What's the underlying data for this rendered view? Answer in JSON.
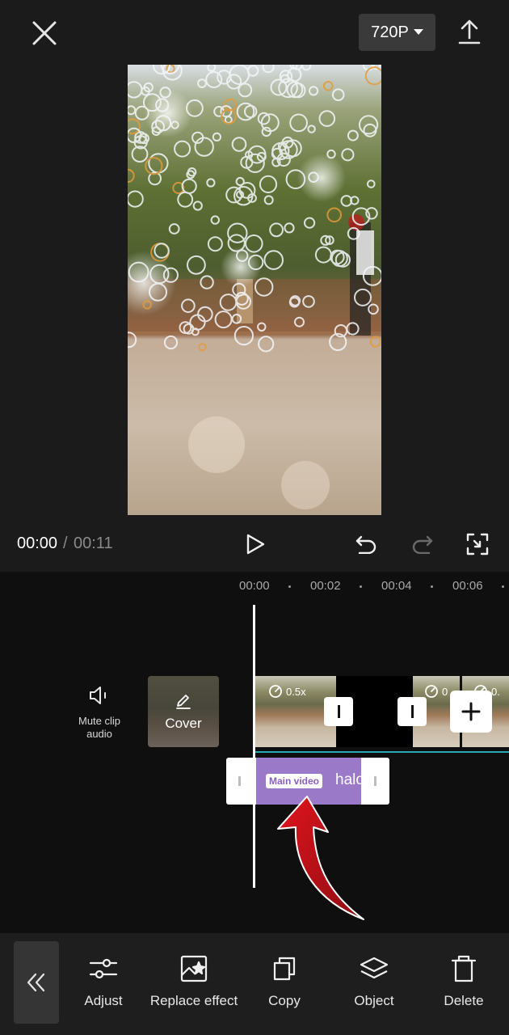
{
  "header": {
    "resolution_label": "720P"
  },
  "playback": {
    "current_time": "00:00",
    "separator": "/",
    "total_time": "00:11"
  },
  "timeline": {
    "ruler": [
      "00:00",
      "00:02",
      "00:04",
      "00:06"
    ],
    "mute_label": "Mute clip audio",
    "cover_label": "Cover",
    "clip_speed": "0.5x",
    "clip_speed_2": "0",
    "clip_speed_3": "0.",
    "effect_tag": "Main video",
    "effect_name": "halo"
  },
  "toolbar": {
    "items": [
      {
        "label": "Adjust",
        "icon": "adjust-sliders-icon"
      },
      {
        "label": "Replace effect",
        "icon": "replace-effect-icon"
      },
      {
        "label": "Copy",
        "icon": "copy-icon"
      },
      {
        "label": "Object",
        "icon": "layers-icon"
      },
      {
        "label": "Delete",
        "icon": "trash-icon"
      }
    ]
  },
  "colors": {
    "effect_purple": "#9b79c9",
    "track_line": "#2aa8b6",
    "annotation_arrow": "#c0141a"
  }
}
